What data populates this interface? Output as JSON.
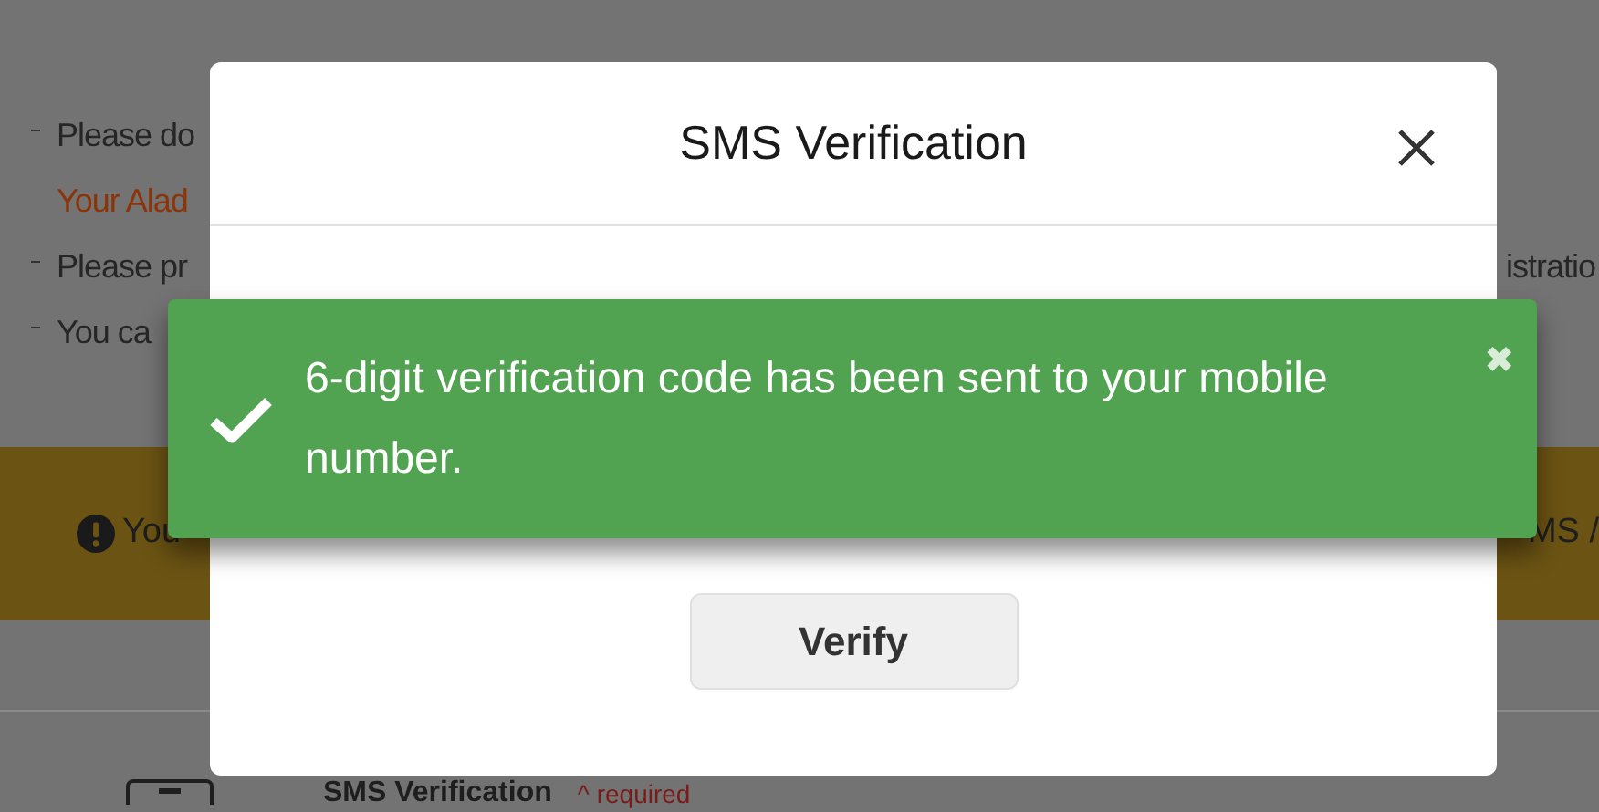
{
  "background": {
    "notes": [
      {
        "text": "Please do",
        "bullet": true,
        "kind": "normal"
      },
      {
        "text": "Your Alad",
        "bullet": false,
        "kind": "warning"
      },
      {
        "text": "Please pr",
        "bullet": true,
        "kind": "normal",
        "trailing": "istratio"
      },
      {
        "text": "You ca",
        "bullet": true,
        "kind": "normal"
      }
    ],
    "notice": {
      "left": "You",
      "right": "MS /"
    },
    "section": {
      "title": "SMS Verification",
      "required": "^ required"
    }
  },
  "dialog": {
    "title": "SMS Verification",
    "button": "Verify"
  },
  "toast": {
    "kind": "success",
    "message": "6-digit verification code has been sent to your mobile number.",
    "close": "✖"
  }
}
